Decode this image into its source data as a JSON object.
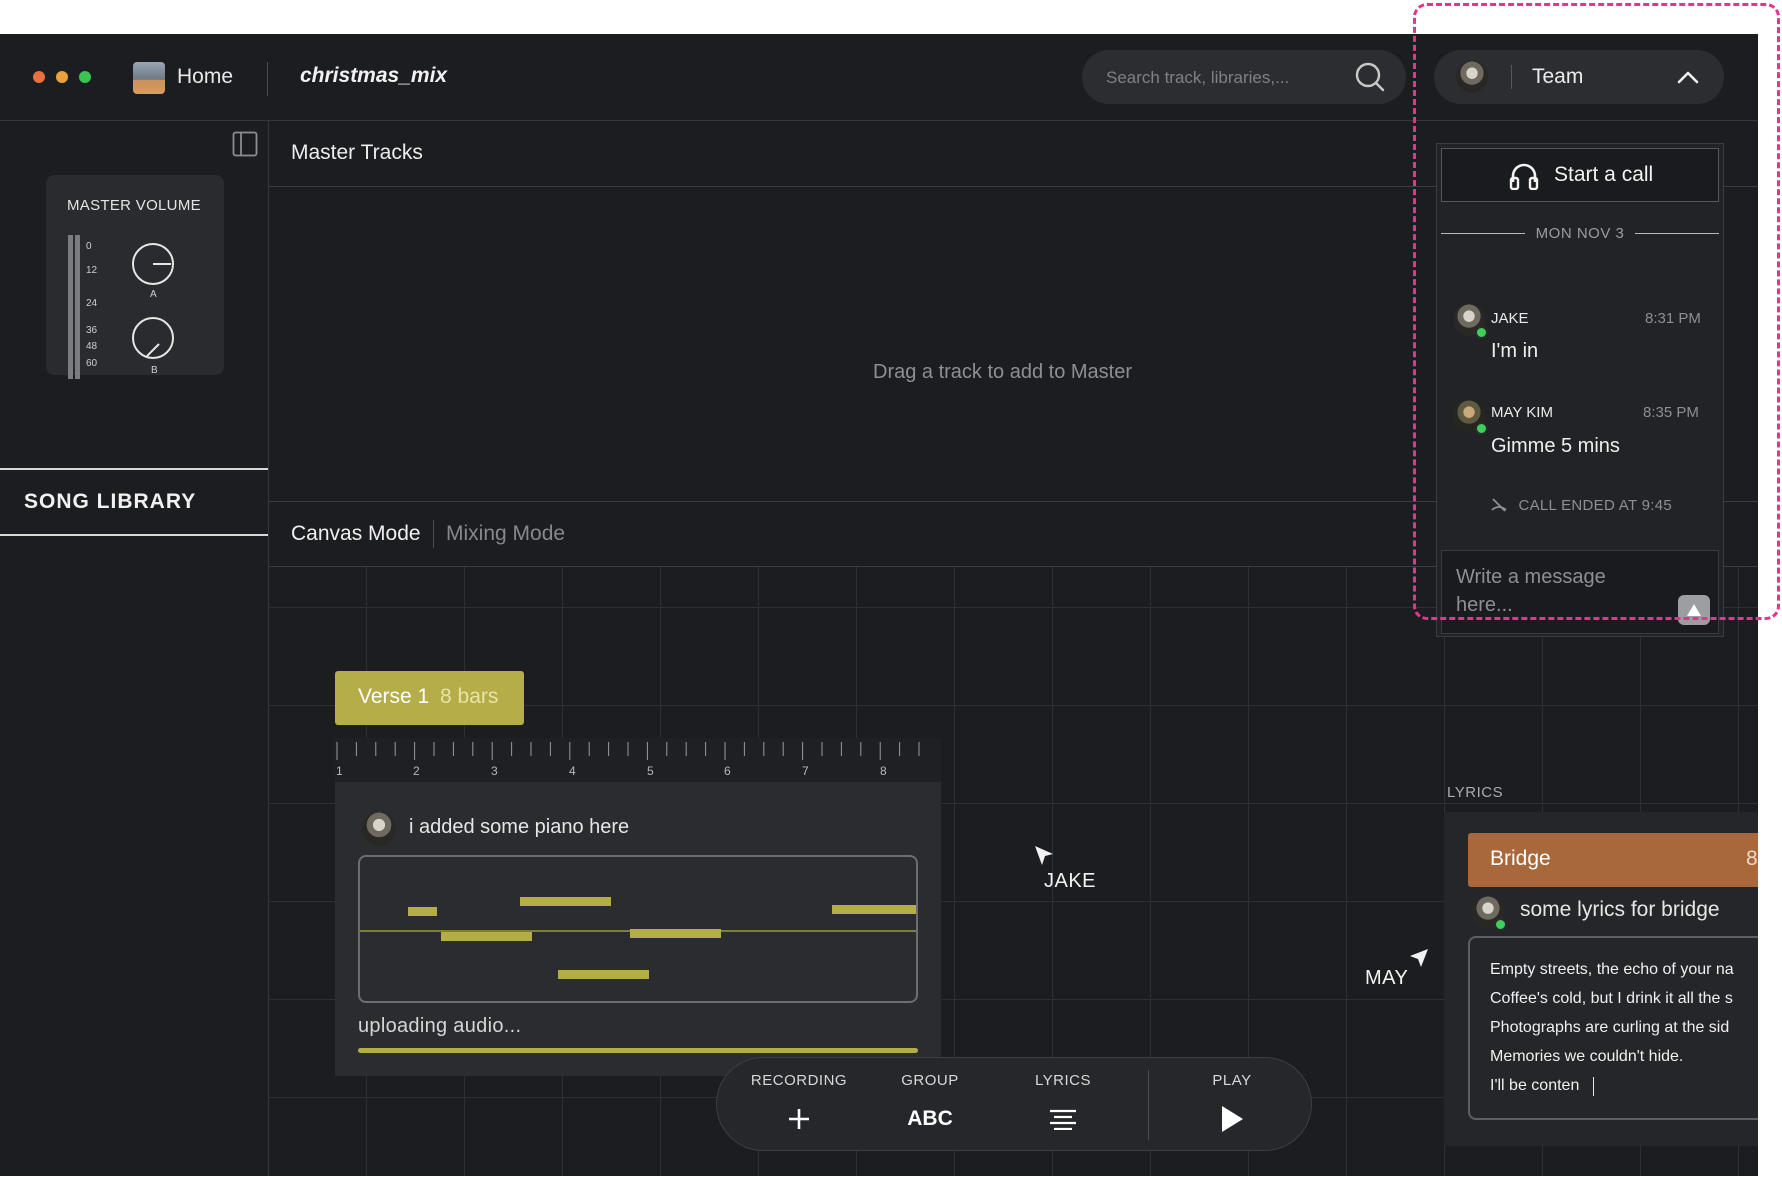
{
  "window": {
    "controls": [
      {
        "name": "close",
        "color": "#e8713f"
      },
      {
        "name": "minimize",
        "color": "#e9a23b"
      },
      {
        "name": "maximize",
        "color": "#39c453"
      }
    ]
  },
  "header": {
    "home_label": "Home",
    "project_name": "christmas_mix",
    "search": {
      "placeholder": "Search track, libraries,...",
      "value": ""
    },
    "team_label": "Team"
  },
  "sidebar": {
    "master_volume": {
      "title": "MASTER VOLUME",
      "scale": [
        "0",
        "12",
        "24",
        "36",
        "48",
        "60"
      ],
      "knobs": [
        {
          "label": "A"
        },
        {
          "label": "B"
        }
      ]
    },
    "song_library_label": "SONG LIBRARY"
  },
  "master_tracks": {
    "title": "Master Tracks",
    "empty_text": "Drag a track to add to Master"
  },
  "modes": {
    "active": "Canvas Mode",
    "inactive": "Mixing Mode"
  },
  "canvas": {
    "verse": {
      "name": "Verse 1",
      "bars": "8 bars",
      "color": "#b4ad48"
    },
    "ruler_numbers": [
      "1",
      "2",
      "3",
      "4",
      "5",
      "6",
      "7",
      "8"
    ],
    "clip_comment": "i added some piano here",
    "upload": {
      "text": "uploading audio...",
      "progress": 1.0
    },
    "cursors": [
      {
        "name": "JAKE"
      },
      {
        "name": "MAY"
      }
    ]
  },
  "toolbar": {
    "recording_label": "RECORDING",
    "group_label": "GROUP",
    "group_icon_text": "ABC",
    "lyrics_label": "LYRICS",
    "play_label": "PLAY"
  },
  "lyrics": {
    "caption": "LYRICS",
    "section": {
      "name": "Bridge",
      "bars": "8",
      "color": "#a8683c"
    },
    "comment": "some lyrics for bridge",
    "lines": [
      "Empty streets, the echo of your na",
      "Coffee's cold, but I drink it all the s",
      "Photographs are curling at the sid",
      "Memories we couldn't hide.",
      "I'll be conten"
    ]
  },
  "chat": {
    "call_button_label": "Start a call",
    "date_label": "MON NOV 3",
    "messages": [
      {
        "author": "JAKE",
        "time": "8:31 PM",
        "text": "I'm in"
      },
      {
        "author": "MAY KIM",
        "time": "8:35 PM",
        "text": "Gimme 5 mins"
      }
    ],
    "call_ended_text": "CALL ENDED AT 9:45",
    "input_placeholder": "Write a message here..."
  },
  "colors": {
    "accent_verse": "#b4ad48",
    "accent_bridge": "#a8683c",
    "highlight_dashed": "#e8338e",
    "background": "#1c1d20"
  }
}
